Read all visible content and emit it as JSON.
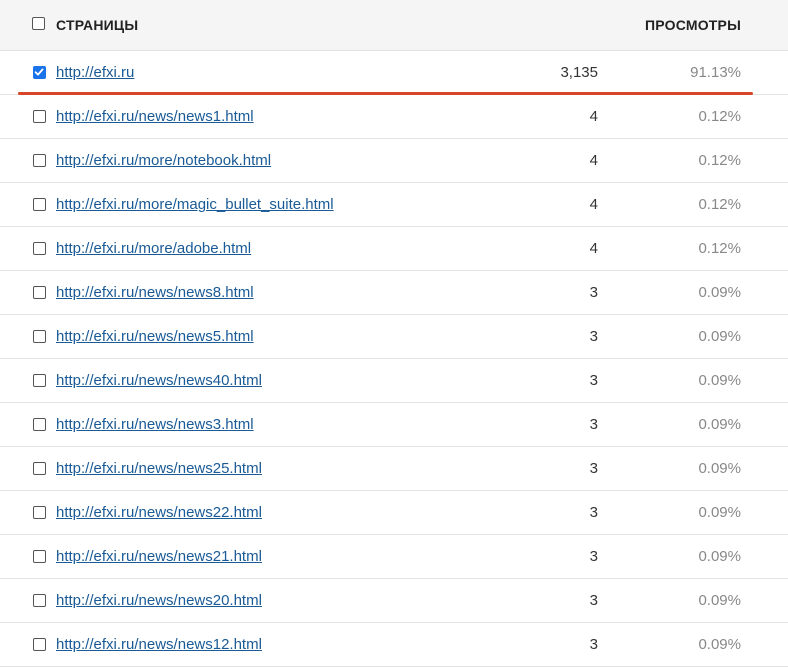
{
  "header": {
    "select_all_checked": false,
    "pages_label": "СТРАНИЦЫ",
    "views_label": "ПРОСМОТРЫ"
  },
  "rows": [
    {
      "url": "http://efxi.ru",
      "views": "3,135",
      "percent": "91.13%",
      "checked": true
    },
    {
      "url": "http://efxi.ru/news/news1.html",
      "views": "4",
      "percent": "0.12%",
      "checked": false
    },
    {
      "url": "http://efxi.ru/more/notebook.html",
      "views": "4",
      "percent": "0.12%",
      "checked": false
    },
    {
      "url": "http://efxi.ru/more/magic_bullet_suite.html",
      "views": "4",
      "percent": "0.12%",
      "checked": false
    },
    {
      "url": "http://efxi.ru/more/adobe.html",
      "views": "4",
      "percent": "0.12%",
      "checked": false
    },
    {
      "url": "http://efxi.ru/news/news8.html",
      "views": "3",
      "percent": "0.09%",
      "checked": false
    },
    {
      "url": "http://efxi.ru/news/news5.html",
      "views": "3",
      "percent": "0.09%",
      "checked": false
    },
    {
      "url": "http://efxi.ru/news/news40.html",
      "views": "3",
      "percent": "0.09%",
      "checked": false
    },
    {
      "url": "http://efxi.ru/news/news3.html",
      "views": "3",
      "percent": "0.09%",
      "checked": false
    },
    {
      "url": "http://efxi.ru/news/news25.html",
      "views": "3",
      "percent": "0.09%",
      "checked": false
    },
    {
      "url": "http://efxi.ru/news/news22.html",
      "views": "3",
      "percent": "0.09%",
      "checked": false
    },
    {
      "url": "http://efxi.ru/news/news21.html",
      "views": "3",
      "percent": "0.09%",
      "checked": false
    },
    {
      "url": "http://efxi.ru/news/news20.html",
      "views": "3",
      "percent": "0.09%",
      "checked": false
    },
    {
      "url": "http://efxi.ru/news/news12.html",
      "views": "3",
      "percent": "0.09%",
      "checked": false
    }
  ],
  "colors": {
    "link": "#1a5a96",
    "checkbox_checked": "#1a73e8",
    "highlight_underline": "#d9452a",
    "header_background": "#f5f5f5"
  }
}
